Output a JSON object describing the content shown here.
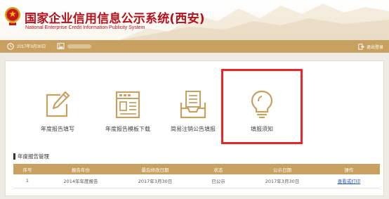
{
  "header": {
    "title_cn": "国家企业信用信息公示系统(西安)",
    "title_en": "National Enterprise Credit Information Publicity System",
    "brand_color": "#b3121c"
  },
  "topbar": {
    "date": "2017年3月30日",
    "logout_label": "退出登录",
    "bar_color": "#c8a060"
  },
  "tiles": [
    {
      "label": "年度报告填写",
      "icon": "pencil-edit-icon"
    },
    {
      "label": "年度报告模板下载",
      "icon": "template-document-icon"
    },
    {
      "label": "简易注销公告填报",
      "icon": "inbox-tray-icon"
    },
    {
      "label": "填报须知",
      "icon": "lightbulb-icon"
    }
  ],
  "highlight_color": "#e8262b",
  "section": {
    "title": "年度报告管理"
  },
  "table": {
    "headers": [
      "序号",
      "报告年份",
      "最后修改日期",
      "状态",
      "公示日期",
      "操作"
    ],
    "rows": [
      [
        "1",
        "2014年年度报告",
        "2017年3月30日",
        "已公示",
        "2017年3月30日",
        "查看或打印"
      ]
    ]
  }
}
